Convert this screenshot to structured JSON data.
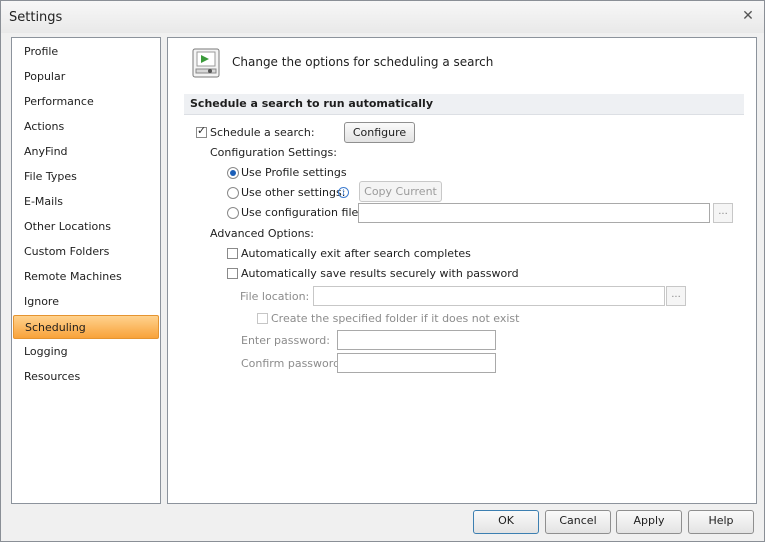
{
  "window": {
    "title": "Settings"
  },
  "sidebar": {
    "items": [
      {
        "label": "Profile"
      },
      {
        "label": "Popular"
      },
      {
        "label": "Performance"
      },
      {
        "label": "Actions"
      },
      {
        "label": "AnyFind"
      },
      {
        "label": "File Types"
      },
      {
        "label": "E-Mails"
      },
      {
        "label": "Other Locations"
      },
      {
        "label": "Custom Folders"
      },
      {
        "label": "Remote Machines"
      },
      {
        "label": "Ignore"
      },
      {
        "label": "Scheduling",
        "active": true
      },
      {
        "label": "Logging"
      },
      {
        "label": "Resources"
      }
    ]
  },
  "header": {
    "title": "Change the options for scheduling a search"
  },
  "section": {
    "title": "Schedule a search to run automatically"
  },
  "schedule": {
    "checkbox_label": "Schedule a search:",
    "checked": true,
    "configure_label": "Configure"
  },
  "config": {
    "heading": "Configuration Settings:",
    "use_profile_label": "Use Profile settings",
    "use_other_label": "Use other settings:",
    "copy_current_label": "Copy Current",
    "use_file_label": "Use configuration file:",
    "file_value": "",
    "browse_label": "..."
  },
  "advanced": {
    "heading": "Advanced Options:",
    "auto_exit_label": "Automatically exit after search completes",
    "auto_save_label": "Automatically save results securely with password",
    "file_location_label": "File location:",
    "file_location_value": "",
    "browse_label": "...",
    "create_folder_label": "Create the specified folder if it does not exist",
    "enter_password_label": "Enter password:",
    "confirm_password_label": "Confirm password:"
  },
  "footer": {
    "ok_label": "OK",
    "cancel_label": "Cancel",
    "apply_label": "Apply",
    "help_label": "Help"
  },
  "colors": {
    "active_item": "#f8a23a",
    "radio_dot": "#1c5fb8",
    "section_bg": "#eef0f3"
  },
  "icons": {
    "close": "close-icon",
    "scheduling": "scheduling-icon",
    "info": "info-icon"
  }
}
